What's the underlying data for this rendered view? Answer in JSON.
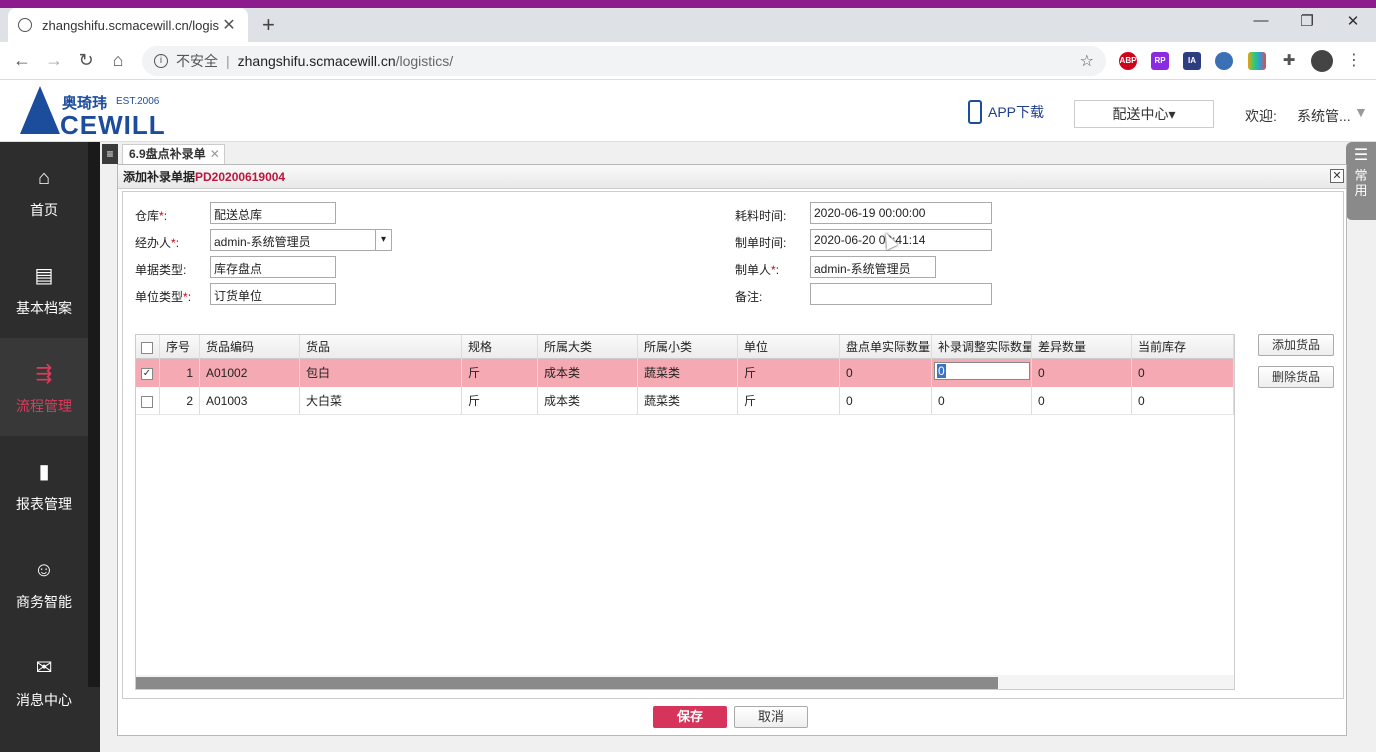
{
  "browser": {
    "tab_title": "zhangshifu.scmacewill.cn/logis",
    "tab_close": "✕",
    "new_tab": "+",
    "win_minimize": "—",
    "win_restore": "❐",
    "win_close": "✕",
    "back": "←",
    "forward": "→",
    "reload": "↻",
    "home": "⌂",
    "insecure_label": "不安全",
    "separator": "|",
    "url_host": "zhangshifu.scmacewill.cn",
    "url_path": "/logistics/",
    "star": "☆",
    "extensions": [
      {
        "label": "ABP",
        "color": "#d0021b"
      },
      {
        "label": "RP",
        "color": "#8a2be2"
      },
      {
        "label": "IA",
        "color": "#2c3e80"
      },
      {
        "label": "",
        "color": "#3b6fb6"
      },
      {
        "label": "",
        "color": "#e8a317"
      },
      {
        "label": "✚",
        "color": "#555555"
      },
      {
        "label": "",
        "color": "#444444"
      }
    ],
    "menu_dots": "⋮"
  },
  "header": {
    "logo_cn": "奥琦玮",
    "logo_est": "EST.2006",
    "logo_en": "CEWILL",
    "app_download": "APP下载",
    "center_button": "配送中心▾",
    "welcome": "欢迎:",
    "user": "系统管...",
    "user_arrow": "▼"
  },
  "sidebar": {
    "items": [
      {
        "label": "首页",
        "icon": "⌂"
      },
      {
        "label": "基本档案",
        "icon": "▤"
      },
      {
        "label": "流程管理",
        "icon": "⇶"
      },
      {
        "label": "报表管理",
        "icon": "▮"
      },
      {
        "label": "商务智能",
        "icon": "☺"
      },
      {
        "label": "消息中心",
        "icon": "✉"
      }
    ]
  },
  "content": {
    "menu_icon": "≡",
    "page_tab": "6.9盘点补录单",
    "page_tab_close": "✕",
    "right_flag_lines": "☰",
    "right_flag_label": "常用"
  },
  "dialog": {
    "title_prefix": "添加补录单据",
    "title_code": "PD20200619004",
    "close": "✕",
    "fields": {
      "warehouse_label": "仓库",
      "warehouse_value": "配送总库",
      "handler_label": "经办人",
      "handler_value": "admin-系统管理员",
      "doc_type_label": "单据类型:",
      "doc_type_value": "库存盘点",
      "unit_type_label": "单位类型",
      "unit_type_value": "订货单位",
      "consume_time_label": "耗料时间:",
      "consume_time_value": "2020-06-19 00:00:00",
      "create_time_label": "制单时间:",
      "create_time_value": "2020-06-20 09:41:14",
      "creator_label": "制单人",
      "creator_value": "admin-系统管理员",
      "remark_label": "备注:",
      "remark_value": "",
      "required_mark": "*",
      "colon": ":",
      "select_arrow": "▾"
    },
    "grid": {
      "columns": [
        "序号",
        "货品编码",
        "货品",
        "规格",
        "所属大类",
        "所属小类",
        "单位",
        "盘点单实际数量",
        "补录调整实际数量",
        "差异数量",
        "当前库存"
      ],
      "rows": [
        {
          "checked": true,
          "cells": [
            "1",
            "A01002",
            "包白",
            "斤",
            "成本类",
            "蔬菜类",
            "斤",
            "0",
            "0",
            "0",
            "0"
          ]
        },
        {
          "checked": false,
          "cells": [
            "2",
            "A01003",
            "大白菜",
            "斤",
            "成本类",
            "蔬菜类",
            "斤",
            "0",
            "0",
            "0",
            "0"
          ]
        }
      ],
      "check_mark": "✓"
    },
    "add_goods": "添加货品",
    "delete_goods": "删除货品",
    "save": "保存",
    "cancel": "取消"
  }
}
